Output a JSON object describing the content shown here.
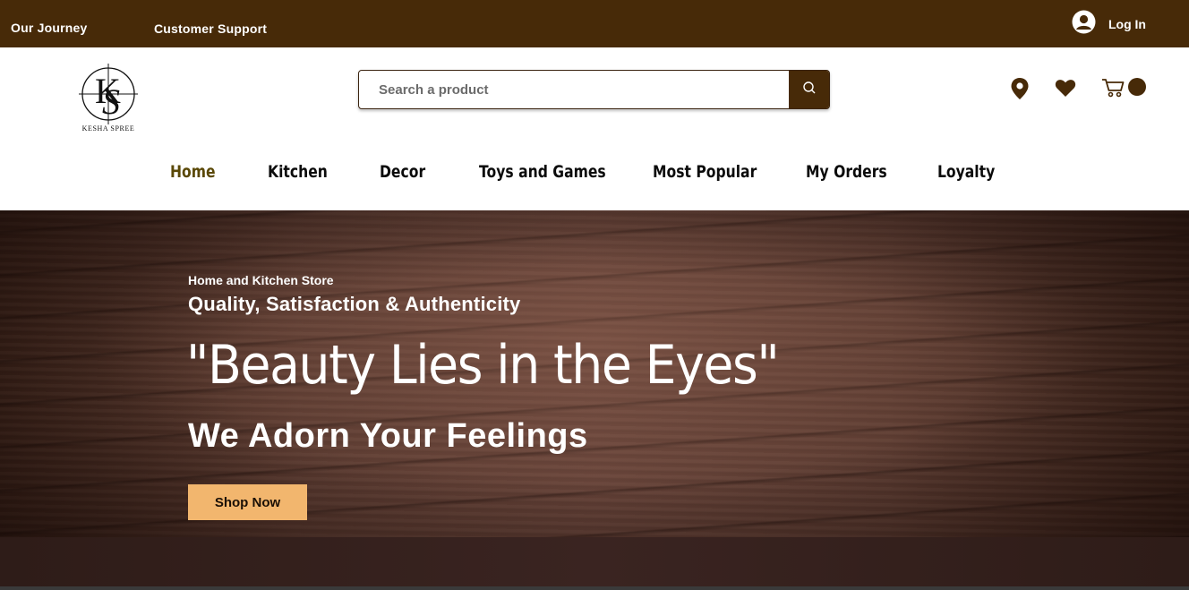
{
  "topbar": {
    "links": [
      {
        "label": "Our Journey"
      },
      {
        "label": "Customer Support"
      }
    ],
    "login_label": "Log In"
  },
  "brand": {
    "name": "KESHA SPREE",
    "monogram": "KS"
  },
  "search": {
    "placeholder": "Search a product",
    "value": ""
  },
  "header_icons": [
    "location-icon",
    "heart-icon",
    "cart-icon"
  ],
  "nav": {
    "items": [
      {
        "label": "Home",
        "active": true
      },
      {
        "label": "Kitchen"
      },
      {
        "label": "Decor"
      },
      {
        "label": "Toys and Games"
      },
      {
        "label": "Most Popular"
      },
      {
        "label": "My Orders"
      },
      {
        "label": "Loyalty"
      }
    ]
  },
  "hero": {
    "kicker": "Home and Kitchen Store",
    "subtitle": "Quality, Satisfaction & Authenticity",
    "title": "\"Beauty Lies in the Eyes\"",
    "tagline": "We Adorn Your Feelings",
    "cta": "Shop Now"
  },
  "colors": {
    "brand_brown": "#472a08",
    "active_nav": "#5a4807",
    "cta": "#f2b66e"
  }
}
